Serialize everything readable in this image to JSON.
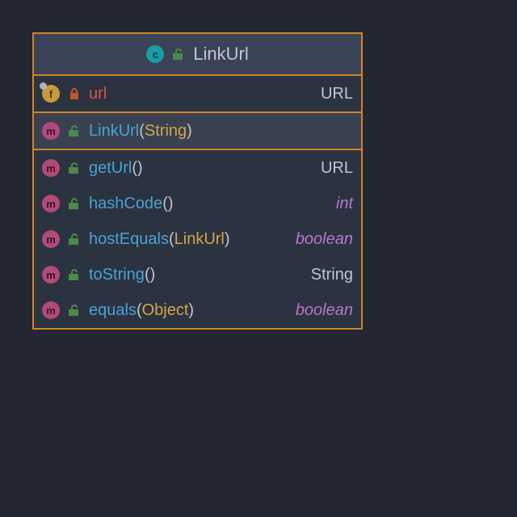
{
  "class": {
    "name": "LinkUrl",
    "icon": "c",
    "visibility": "public"
  },
  "fields": [
    {
      "icon": "f",
      "visibility": "private",
      "name": "url",
      "type": "URL",
      "primitive": false
    }
  ],
  "constructors": [
    {
      "icon": "m",
      "visibility": "public",
      "name": "LinkUrl",
      "params": "String",
      "highlighted": true
    }
  ],
  "methods": [
    {
      "icon": "m",
      "visibility": "public",
      "name": "getUrl",
      "params": "",
      "returnType": "URL",
      "primitive": false
    },
    {
      "icon": "m",
      "visibility": "public",
      "name": "hashCode",
      "params": "",
      "returnType": "int",
      "primitive": true
    },
    {
      "icon": "m",
      "visibility": "public",
      "name": "hostEquals",
      "params": "LinkUrl",
      "returnType": "boolean",
      "primitive": true
    },
    {
      "icon": "m",
      "visibility": "public",
      "name": "toString",
      "params": "",
      "returnType": "String",
      "primitive": false
    },
    {
      "icon": "m",
      "visibility": "public",
      "name": "equals",
      "params": "Object",
      "returnType": "boolean",
      "primitive": true
    }
  ]
}
